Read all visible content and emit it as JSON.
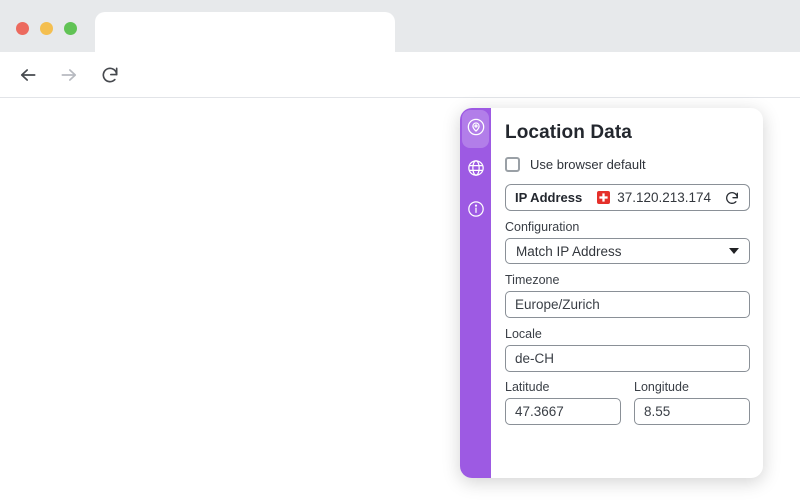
{
  "browser": {
    "window_controls": {
      "close": "red",
      "minimize": "yellow",
      "maximize": "green"
    },
    "address_value": "",
    "icons": {
      "back": "arrow-left",
      "forward": "arrow-right",
      "reload": "circular-arrow",
      "extension": "vytal-rings-keyhole",
      "menu": "three-dots-vertical"
    }
  },
  "popup": {
    "title": "Location Data",
    "sidebar": {
      "active_index": 0,
      "items": [
        {
          "icon": "location-pin-circle"
        },
        {
          "icon": "globe"
        },
        {
          "icon": "info-circle"
        }
      ]
    },
    "checkbox": {
      "label": "Use browser default",
      "checked": false
    },
    "ip": {
      "label": "IP Address",
      "value": "37.120.213.174",
      "flag": "CH"
    },
    "fields": [
      {
        "label": "Configuration",
        "value": "Match IP Address",
        "type": "select"
      },
      {
        "label": "Timezone",
        "value": "Europe/Zurich",
        "type": "text"
      },
      {
        "label": "Locale",
        "value": "de-CH",
        "type": "text"
      }
    ],
    "coords": [
      {
        "label": "Latitude",
        "value": "47.3667"
      },
      {
        "label": "Longitude",
        "value": "8.55"
      }
    ],
    "colors": {
      "sidebar_purple": "#9d5ae3",
      "accent_purple": "#8b3fe8",
      "flag_red": "#e5302a",
      "input_border": "#8a9097",
      "title_text": "#23272e"
    }
  }
}
